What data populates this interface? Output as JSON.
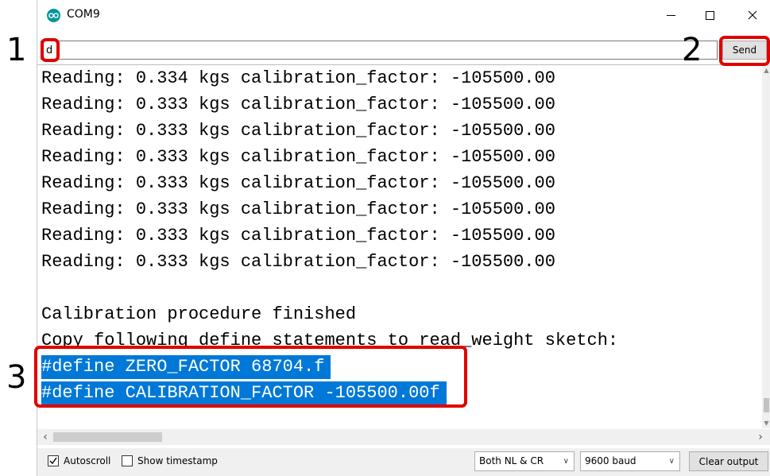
{
  "annotations": [
    "1",
    "2",
    "3"
  ],
  "window": {
    "title": "COM9",
    "minimize_glyph": "—",
    "close_glyph": "✕"
  },
  "input": {
    "value": "d",
    "send_label": "Send"
  },
  "output": {
    "lines": [
      "Reading: 0.334 kgs calibration_factor: -105500.00",
      "Reading: 0.333 kgs calibration_factor: -105500.00",
      "Reading: 0.333 kgs calibration_factor: -105500.00",
      "Reading: 0.333 kgs calibration_factor: -105500.00",
      "Reading: 0.333 kgs calibration_factor: -105500.00",
      "Reading: 0.333 kgs calibration_factor: -105500.00",
      "Reading: 0.333 kgs calibration_factor: -105500.00",
      "Reading: 0.333 kgs calibration_factor: -105500.00",
      "",
      "Calibration procedure finished",
      "Copy following define statements to read_weight sketch:",
      "#define ZERO_FACTOR 68704.f",
      "#define CALIBRATION_FACTOR -105500.00f"
    ],
    "selected_lines": [
      11,
      12
    ]
  },
  "status": {
    "autoscroll_label": "Autoscroll",
    "autoscroll_checked": true,
    "timestamp_label": "Show timestamp",
    "timestamp_checked": false,
    "line_ending": "Both NL & CR",
    "baud": "9600 baud",
    "clear_label": "Clear output"
  },
  "colors": {
    "selection": "#0078d7",
    "highlight_box": "#e00000",
    "arduino_teal": "#00979c"
  },
  "icons": {
    "app": "arduino-logo-icon",
    "minimize": "minimize-icon",
    "maximize": "maximize-icon",
    "close": "close-icon",
    "dropdown": "chevron-down-icon"
  }
}
